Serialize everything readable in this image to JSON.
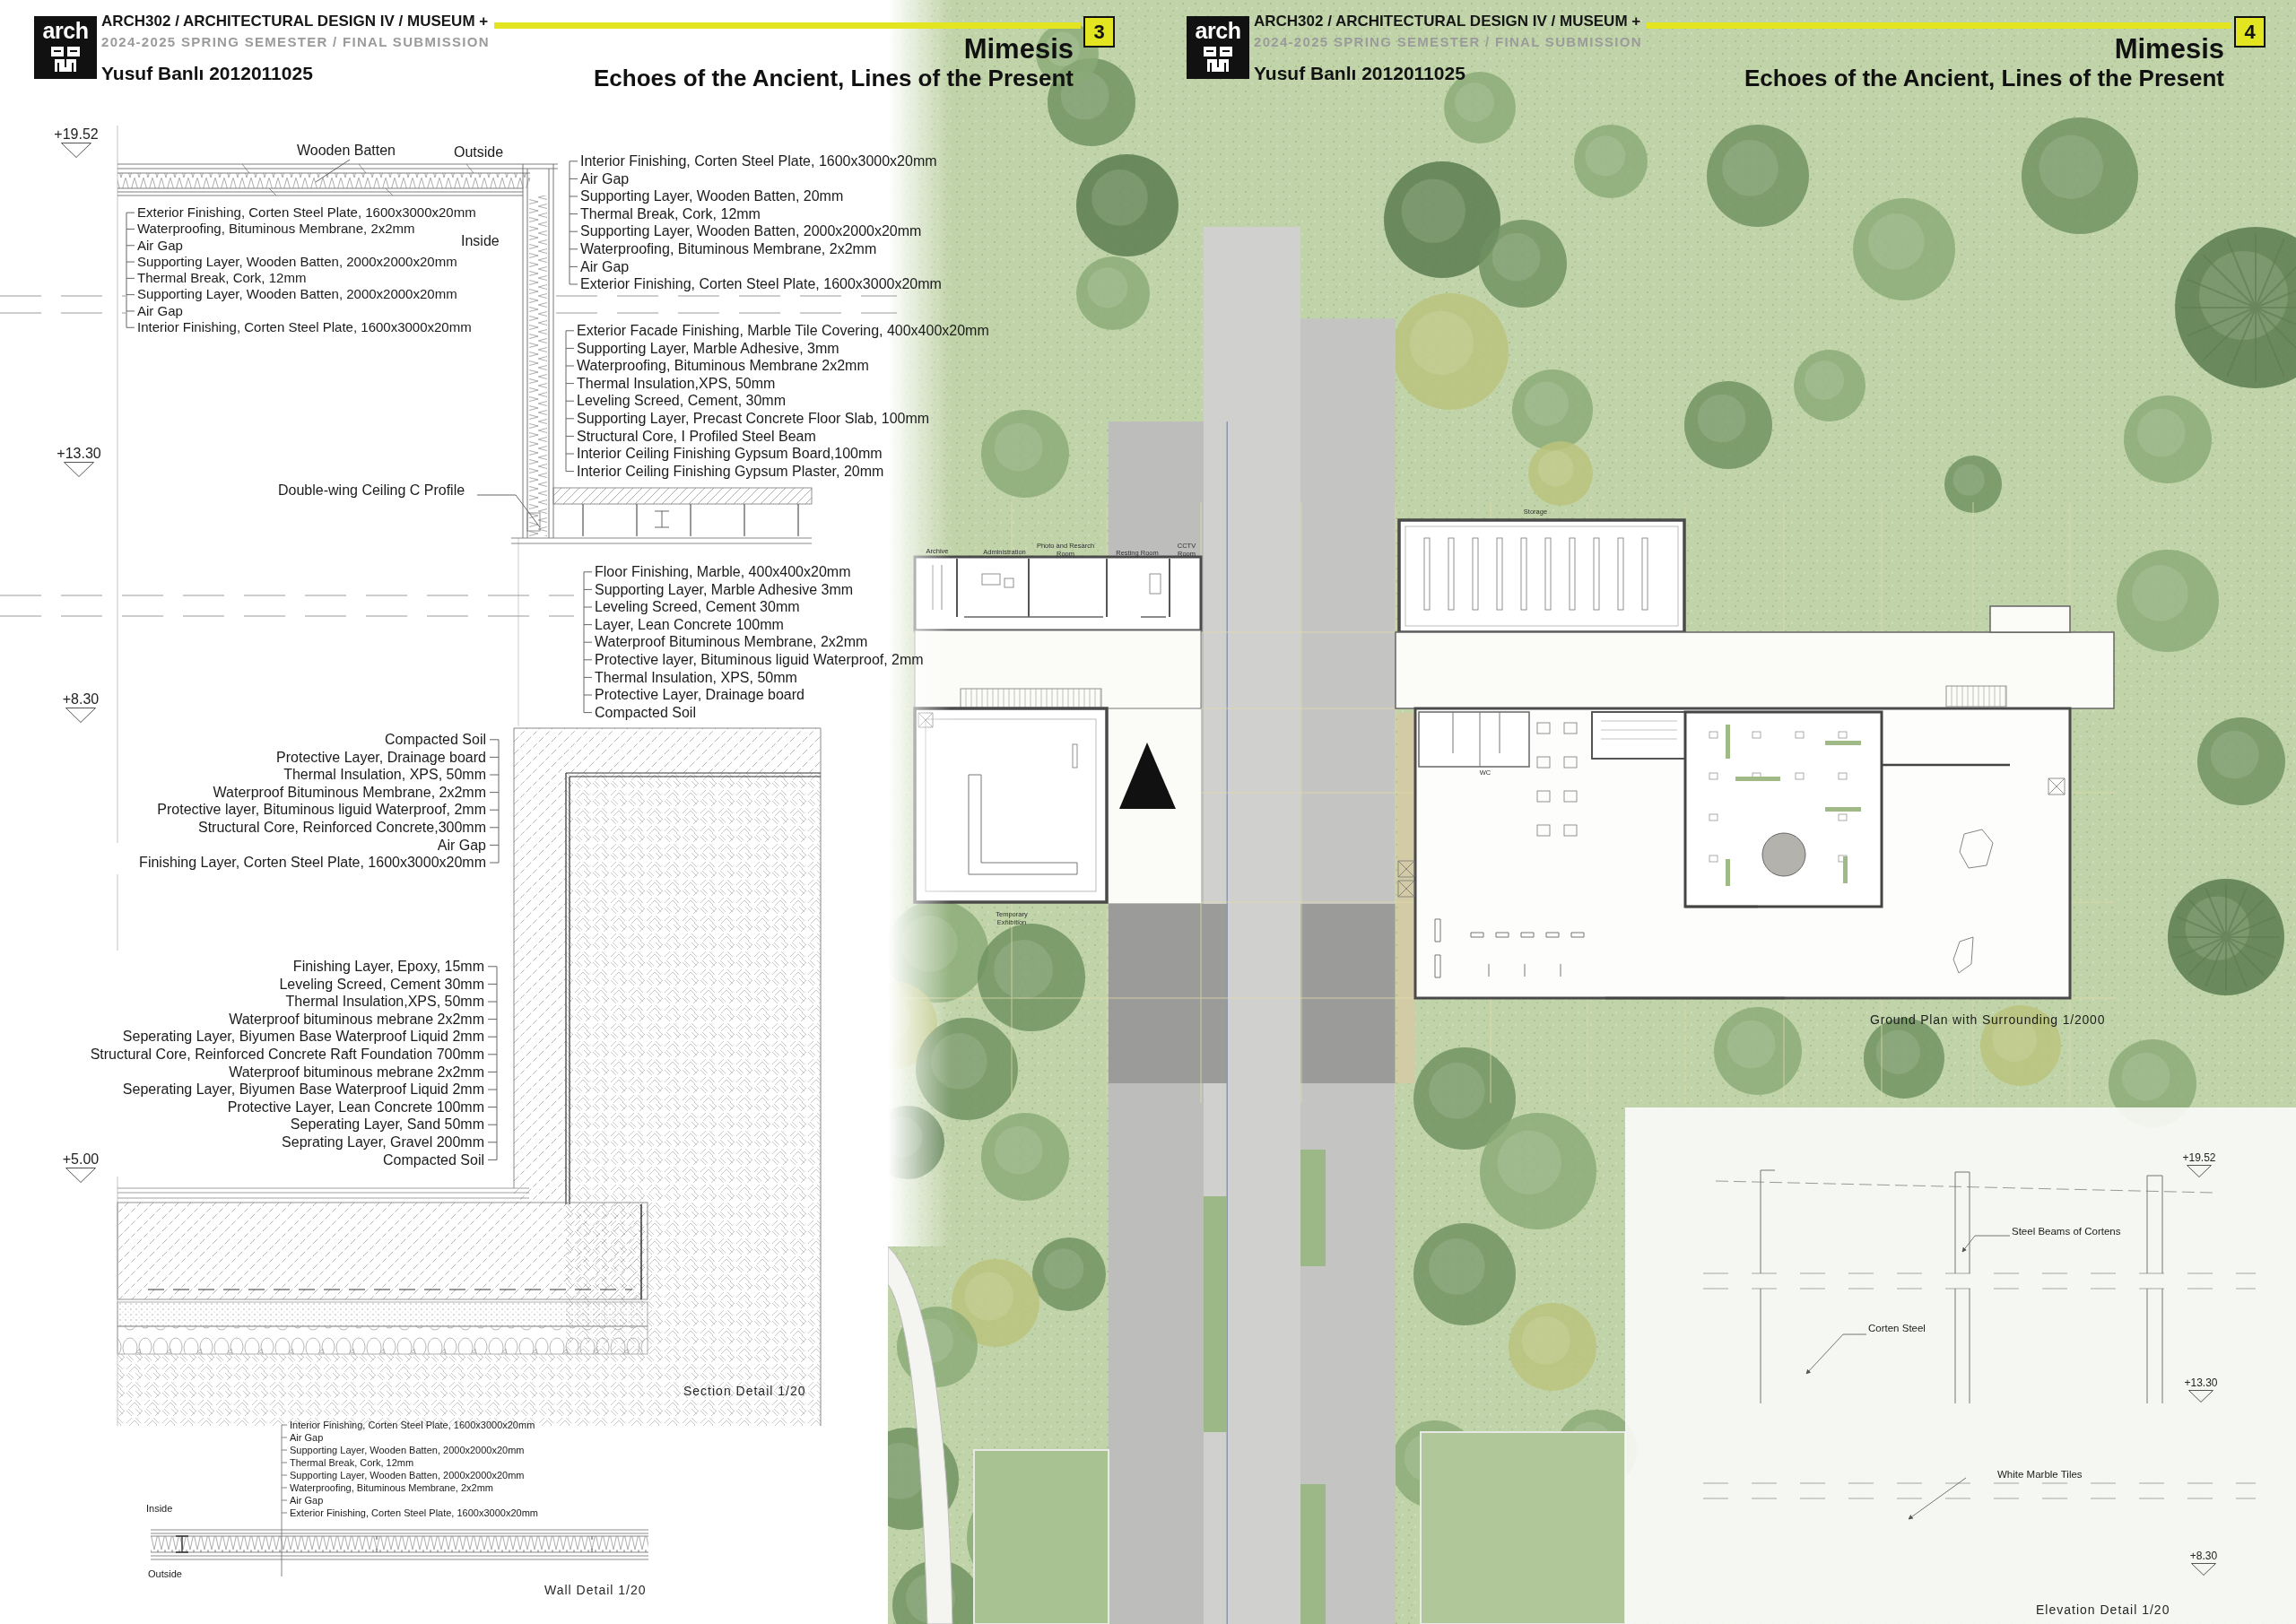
{
  "left_sheet": {
    "header": {
      "logo": "arch",
      "course": "ARCH302 / ARCHITECTURAL DESIGN IV / MUSEUM +",
      "semester": "2024-2025 SPRING SEMESTER / FINAL SUBMISSION",
      "author": "Yusuf Banlı 2012011025",
      "page_number": "3",
      "title": "Mimesis",
      "subtitle": "Echoes of the Ancient, Lines of the Present"
    },
    "section_detail": {
      "levels": [
        "+19.52",
        "+13.30",
        "+8.30",
        "+5.00"
      ],
      "callouts": [
        "Wooden Batten",
        "Outside",
        "Inside",
        "Double-wing Ceiling C Profile"
      ],
      "layer_groups": [
        {
          "labels": [
            "Exterior Finishing, Corten Steel Plate, 1600x3000x20mm",
            "Waterproofing, Bituminous Membrane, 2x2mm",
            "Air Gap",
            "Supporting Layer, Wooden Batten, 2000x2000x20mm",
            "Thermal Break, Cork, 12mm",
            "Supporting Layer, Wooden Batten, 2000x2000x20mm",
            "Air Gap",
            "Interior Finishing, Corten Steel Plate, 1600x3000x20mm"
          ]
        },
        {
          "labels": [
            "Interior Finishing, Corten Steel Plate, 1600x3000x20mm",
            "Air Gap",
            "Supporting Layer, Wooden Batten, 20mm",
            "Thermal Break, Cork, 12mm",
            "Supporting Layer, Wooden Batten, 2000x2000x20mm",
            "Waterproofing, Bituminous Membrane, 2x2mm",
            "Air Gap",
            "Exterior Finishing, Corten Steel Plate, 1600x3000x20mm"
          ]
        },
        {
          "labels": [
            "Exterior Facade Finishing, Marble Tile Covering, 400x400x20mm",
            "Supporting Layer, Marble Adhesive, 3mm",
            "Waterproofing, Bituminous Membrane 2x2mm",
            "Thermal Insulation,XPS, 50mm",
            "Leveling Screed, Cement, 30mm",
            "Supporting Layer, Precast Concrete Floor Slab, 100mm",
            "Structural Core, I Profiled Steel Beam",
            "Interior Ceiling Finishing Gypsum Board,100mm",
            "Interior Ceiling Finishing Gypsum Plaster, 20mm"
          ]
        },
        {
          "labels": [
            "Floor Finishing, Marble, 400x400x20mm",
            "Supporting Layer, Marble Adhesive 3mm",
            "Leveling Screed, Cement 30mm",
            "Layer, Lean Concrete 100mm",
            "Waterproof Bituminous Membrane, 2x2mm",
            "Protective layer, Bituminous liguid Waterproof, 2mm",
            "Thermal Insulation, XPS, 50mm",
            "Protective Layer, Drainage board",
            "Compacted Soil"
          ]
        },
        {
          "labels": [
            "Compacted Soil",
            "Protective Layer, Drainage board",
            "Thermal Insulation, XPS, 50mm",
            "Waterproof Bituminous Membrane, 2x2mm",
            "Protective layer, Bituminous liguid Waterproof, 2mm",
            "Structural Core, Reinforced Concrete,300mm",
            "Air Gap",
            "Finishing Layer, Corten Steel Plate, 1600x3000x20mm"
          ]
        },
        {
          "labels": [
            "Finishing Layer, Epoxy, 15mm",
            "Leveling Screed, Cement 30mm",
            "Thermal Insulation,XPS, 50mm",
            "Waterproof bituminous mebrane 2x2mm",
            "Seperating Layer, Biyumen Base Waterproof Liquid 2mm",
            "Structural Core, Reinforced Concrete Raft Foundation 700mm",
            "Waterproof bituminous mebrane 2x2mm",
            "Seperating Layer, Biyumen Base Waterproof Liquid 2mm",
            "Protective Layer, Lean Concrete 100mm",
            "Seperating Layer, Sand 50mm",
            "Seprating Layer, Gravel 200mm",
            "Compacted Soil"
          ]
        }
      ],
      "caption": "Section Detail 1/20"
    },
    "wall_detail": {
      "layers": [
        "Interior Finishing, Corten Steel Plate, 1600x3000x20mm",
        "Air Gap",
        "Supporting Layer, Wooden Batten, 2000x2000x20mm",
        "Thermal Break, Cork, 12mm",
        "Supporting Layer, Wooden Batten, 2000x2000x20mm",
        "Waterproofing, Bituminous Membrane, 2x2mm",
        "Air Gap",
        "Exterior Finishing, Corten Steel Plate, 1600x3000x20mm"
      ],
      "inside": "Inside",
      "outside": "Outside",
      "caption": "Wall Detail 1/20"
    }
  },
  "site_plan": {
    "rooms": [
      "Archive",
      "Administration",
      "Photo and Resarch Room",
      "Resting Room",
      "CCTV Room",
      "Temporary Exhibition",
      "Storage",
      "WC"
    ],
    "caption": "Ground Plan with Surrounding 1/2000"
  },
  "right_sheet": {
    "header": {
      "logo": "arch",
      "course": "ARCH302 / ARCHITECTURAL DESIGN IV / MUSEUM +",
      "semester": "2024-2025 SPRING SEMESTER / FINAL SUBMISSION",
      "author": "Yusuf Banlı 2012011025",
      "page_number": "4",
      "title": "Mimesis",
      "subtitle": "Echoes of the Ancient, Lines of the Present"
    },
    "elevation_detail": {
      "levels": [
        "+19.52",
        "+13.30",
        "+8.30"
      ],
      "callouts": [
        "Steel Beams of Cortens",
        "Corten Steel",
        "White Marble Tiles"
      ],
      "caption": "Elevation Detail 1/20"
    }
  }
}
